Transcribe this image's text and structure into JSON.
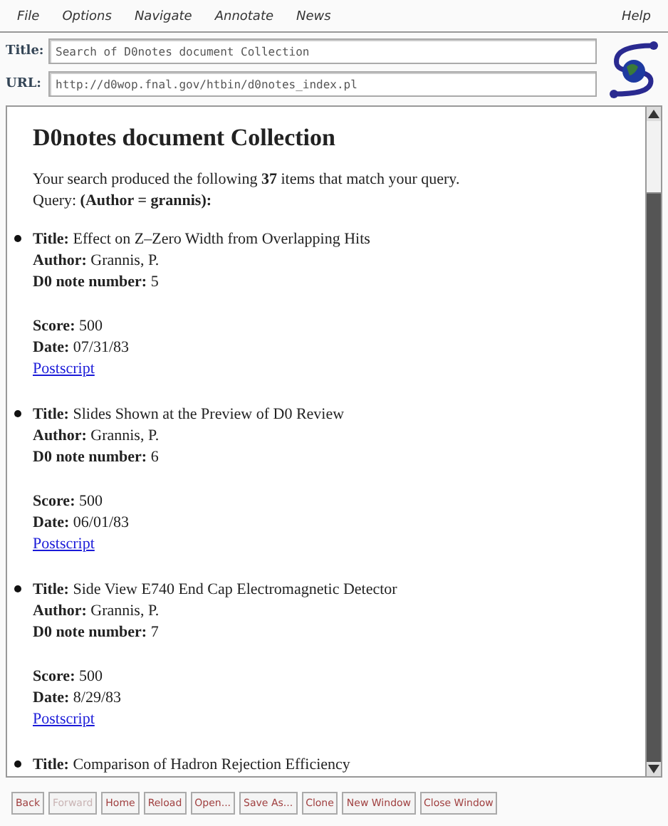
{
  "menu": [
    {
      "label": "File"
    },
    {
      "label": "Options"
    },
    {
      "label": "Navigate"
    },
    {
      "label": "Annotate"
    },
    {
      "label": "News"
    },
    {
      "label": "Help"
    }
  ],
  "title_field": {
    "label": "Title:",
    "value": "Search of D0notes document Collection"
  },
  "url_field": {
    "label": "URL:",
    "value": "http://d0wop.fnal.gov/htbin/d0notes_index.pl"
  },
  "page": {
    "heading": "D0notes document Collection",
    "intro": "Your search produced the following **37** items that match your query.",
    "query": "Query: **(Author = grannis):**",
    "results": [
      {
        "fields": [
          {
            "label": "Title:",
            "value": "Effect on Z–Zero Width from Overlapping Hits"
          },
          {
            "label": "Author:",
            "value": "Grannis, P."
          },
          {
            "label": "D0 note number:",
            "value": "5"
          }
        ],
        "details": [
          {
            "label": "Score:",
            "value": "500"
          },
          {
            "label": "Date:",
            "value": "07/31/83"
          }
        ],
        "link": "Postscript"
      },
      {
        "fields": [
          {
            "label": "Title:",
            "value": "Slides Shown at the Preview of D0 Review"
          },
          {
            "label": "Author:",
            "value": "Grannis, P."
          },
          {
            "label": "D0 note number:",
            "value": "6"
          }
        ],
        "details": [
          {
            "label": "Score:",
            "value": "500"
          },
          {
            "label": "Date:",
            "value": "06/01/83"
          }
        ],
        "link": "Postscript"
      },
      {
        "fields": [
          {
            "label": "Title:",
            "value": "Side View E740 End Cap Electromagnetic Detector"
          },
          {
            "label": "Author:",
            "value": "Grannis, P."
          },
          {
            "label": "D0 note number:",
            "value": "7"
          }
        ],
        "details": [
          {
            "label": "Score:",
            "value": "500"
          },
          {
            "label": "Date:",
            "value": "8/29/83"
          }
        ],
        "link": "Postscript"
      },
      {
        "fields": [
          {
            "label": "Title:",
            "value": "Comparison of Hadron Rejection Efficiency"
          }
        ]
      }
    ]
  },
  "buttons": [
    {
      "label": "Back",
      "disabled": false
    },
    {
      "label": "Forward",
      "disabled": true
    },
    {
      "label": "Home",
      "disabled": false
    },
    {
      "label": "Reload",
      "disabled": false
    },
    {
      "label": "Open...",
      "disabled": false
    },
    {
      "label": "Save As...",
      "disabled": false
    },
    {
      "label": "Clone",
      "disabled": false
    },
    {
      "label": "New Window",
      "disabled": false
    },
    {
      "label": "Close Window",
      "disabled": false
    }
  ]
}
